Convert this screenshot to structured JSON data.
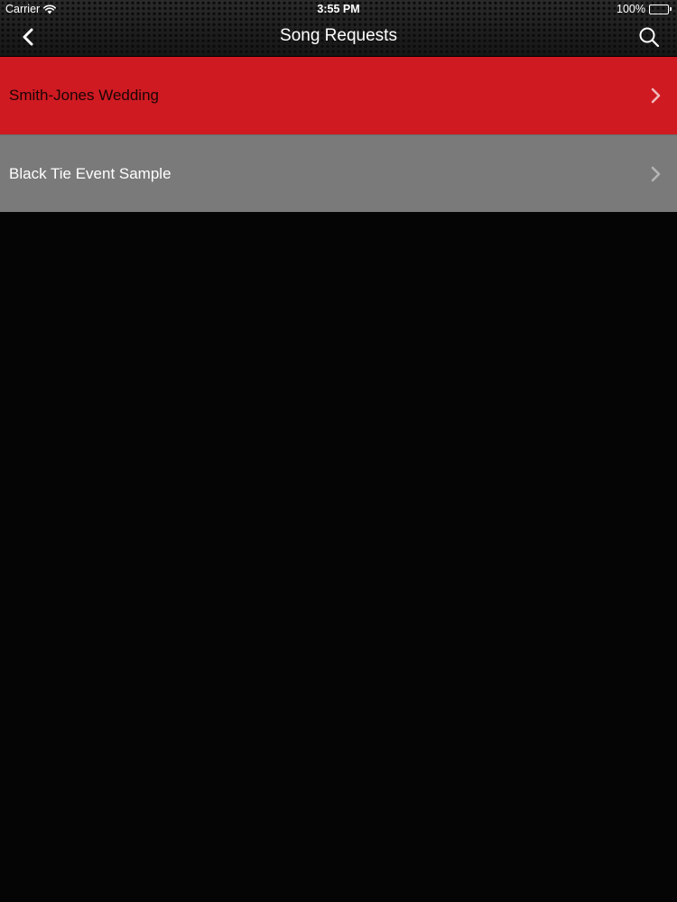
{
  "status_bar": {
    "carrier": "Carrier",
    "time": "3:55 PM",
    "battery": "100%"
  },
  "nav": {
    "title": "Song Requests",
    "back_icon": "chevron-left-icon",
    "search_icon": "search-icon"
  },
  "events": [
    {
      "label": "Smith-Jones Wedding",
      "color": "#cf1a22"
    },
    {
      "label": "Black Tie Event Sample",
      "color": "#7a7a7b"
    }
  ],
  "colors": {
    "accent_red": "#cf1a22",
    "row_gray": "#7a7a7b",
    "background": "#050505"
  }
}
